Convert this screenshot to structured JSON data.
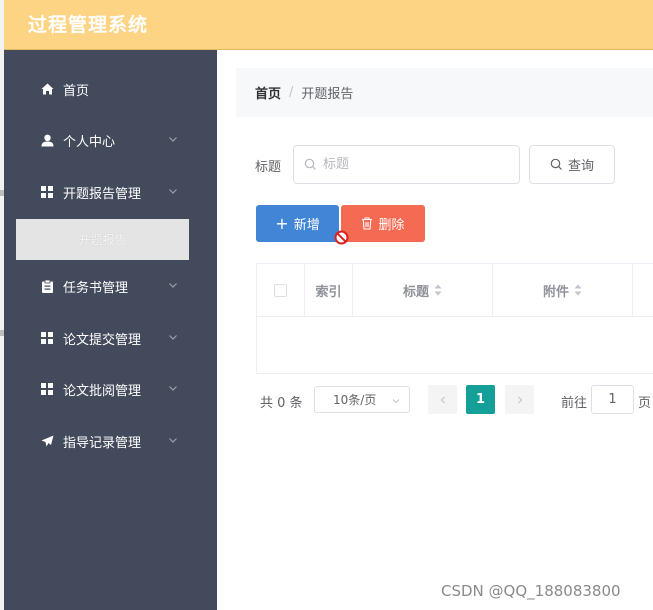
{
  "app": {
    "title": "过程管理系统"
  },
  "sidebar": {
    "items": [
      {
        "label": "首页",
        "icon": "home-icon"
      },
      {
        "label": "个人中心",
        "icon": "user-icon"
      },
      {
        "label": "开题报告管理",
        "icon": "grid-icon"
      },
      {
        "label": "任务书管理",
        "icon": "clipboard-icon"
      },
      {
        "label": "论文提交管理",
        "icon": "grid-icon"
      },
      {
        "label": "论文批阅管理",
        "icon": "grid-icon"
      },
      {
        "label": "指导记录管理",
        "icon": "send-icon"
      }
    ],
    "active_sub": {
      "label": "开题报告"
    }
  },
  "breadcrumb": {
    "home": "首页",
    "separator": "/",
    "current": "开题报告"
  },
  "search": {
    "label": "标题",
    "placeholder": "标题",
    "button": "查询"
  },
  "actions": {
    "add": "新增",
    "delete": "删除"
  },
  "table": {
    "columns": [
      "索引",
      "标题",
      "附件"
    ],
    "rows": []
  },
  "pager": {
    "total": "共 0 条",
    "page_size": "10条/页",
    "current": "1",
    "goto_prefix": "前往",
    "goto_value": "1",
    "goto_suffix": "页"
  },
  "watermark": "CSDN @QQ_188083800",
  "colors": {
    "topbar": "#fdd384",
    "sidebar": "#434a5b",
    "primary": "#4186d6",
    "danger": "#f46a52",
    "accent": "#14a098"
  }
}
